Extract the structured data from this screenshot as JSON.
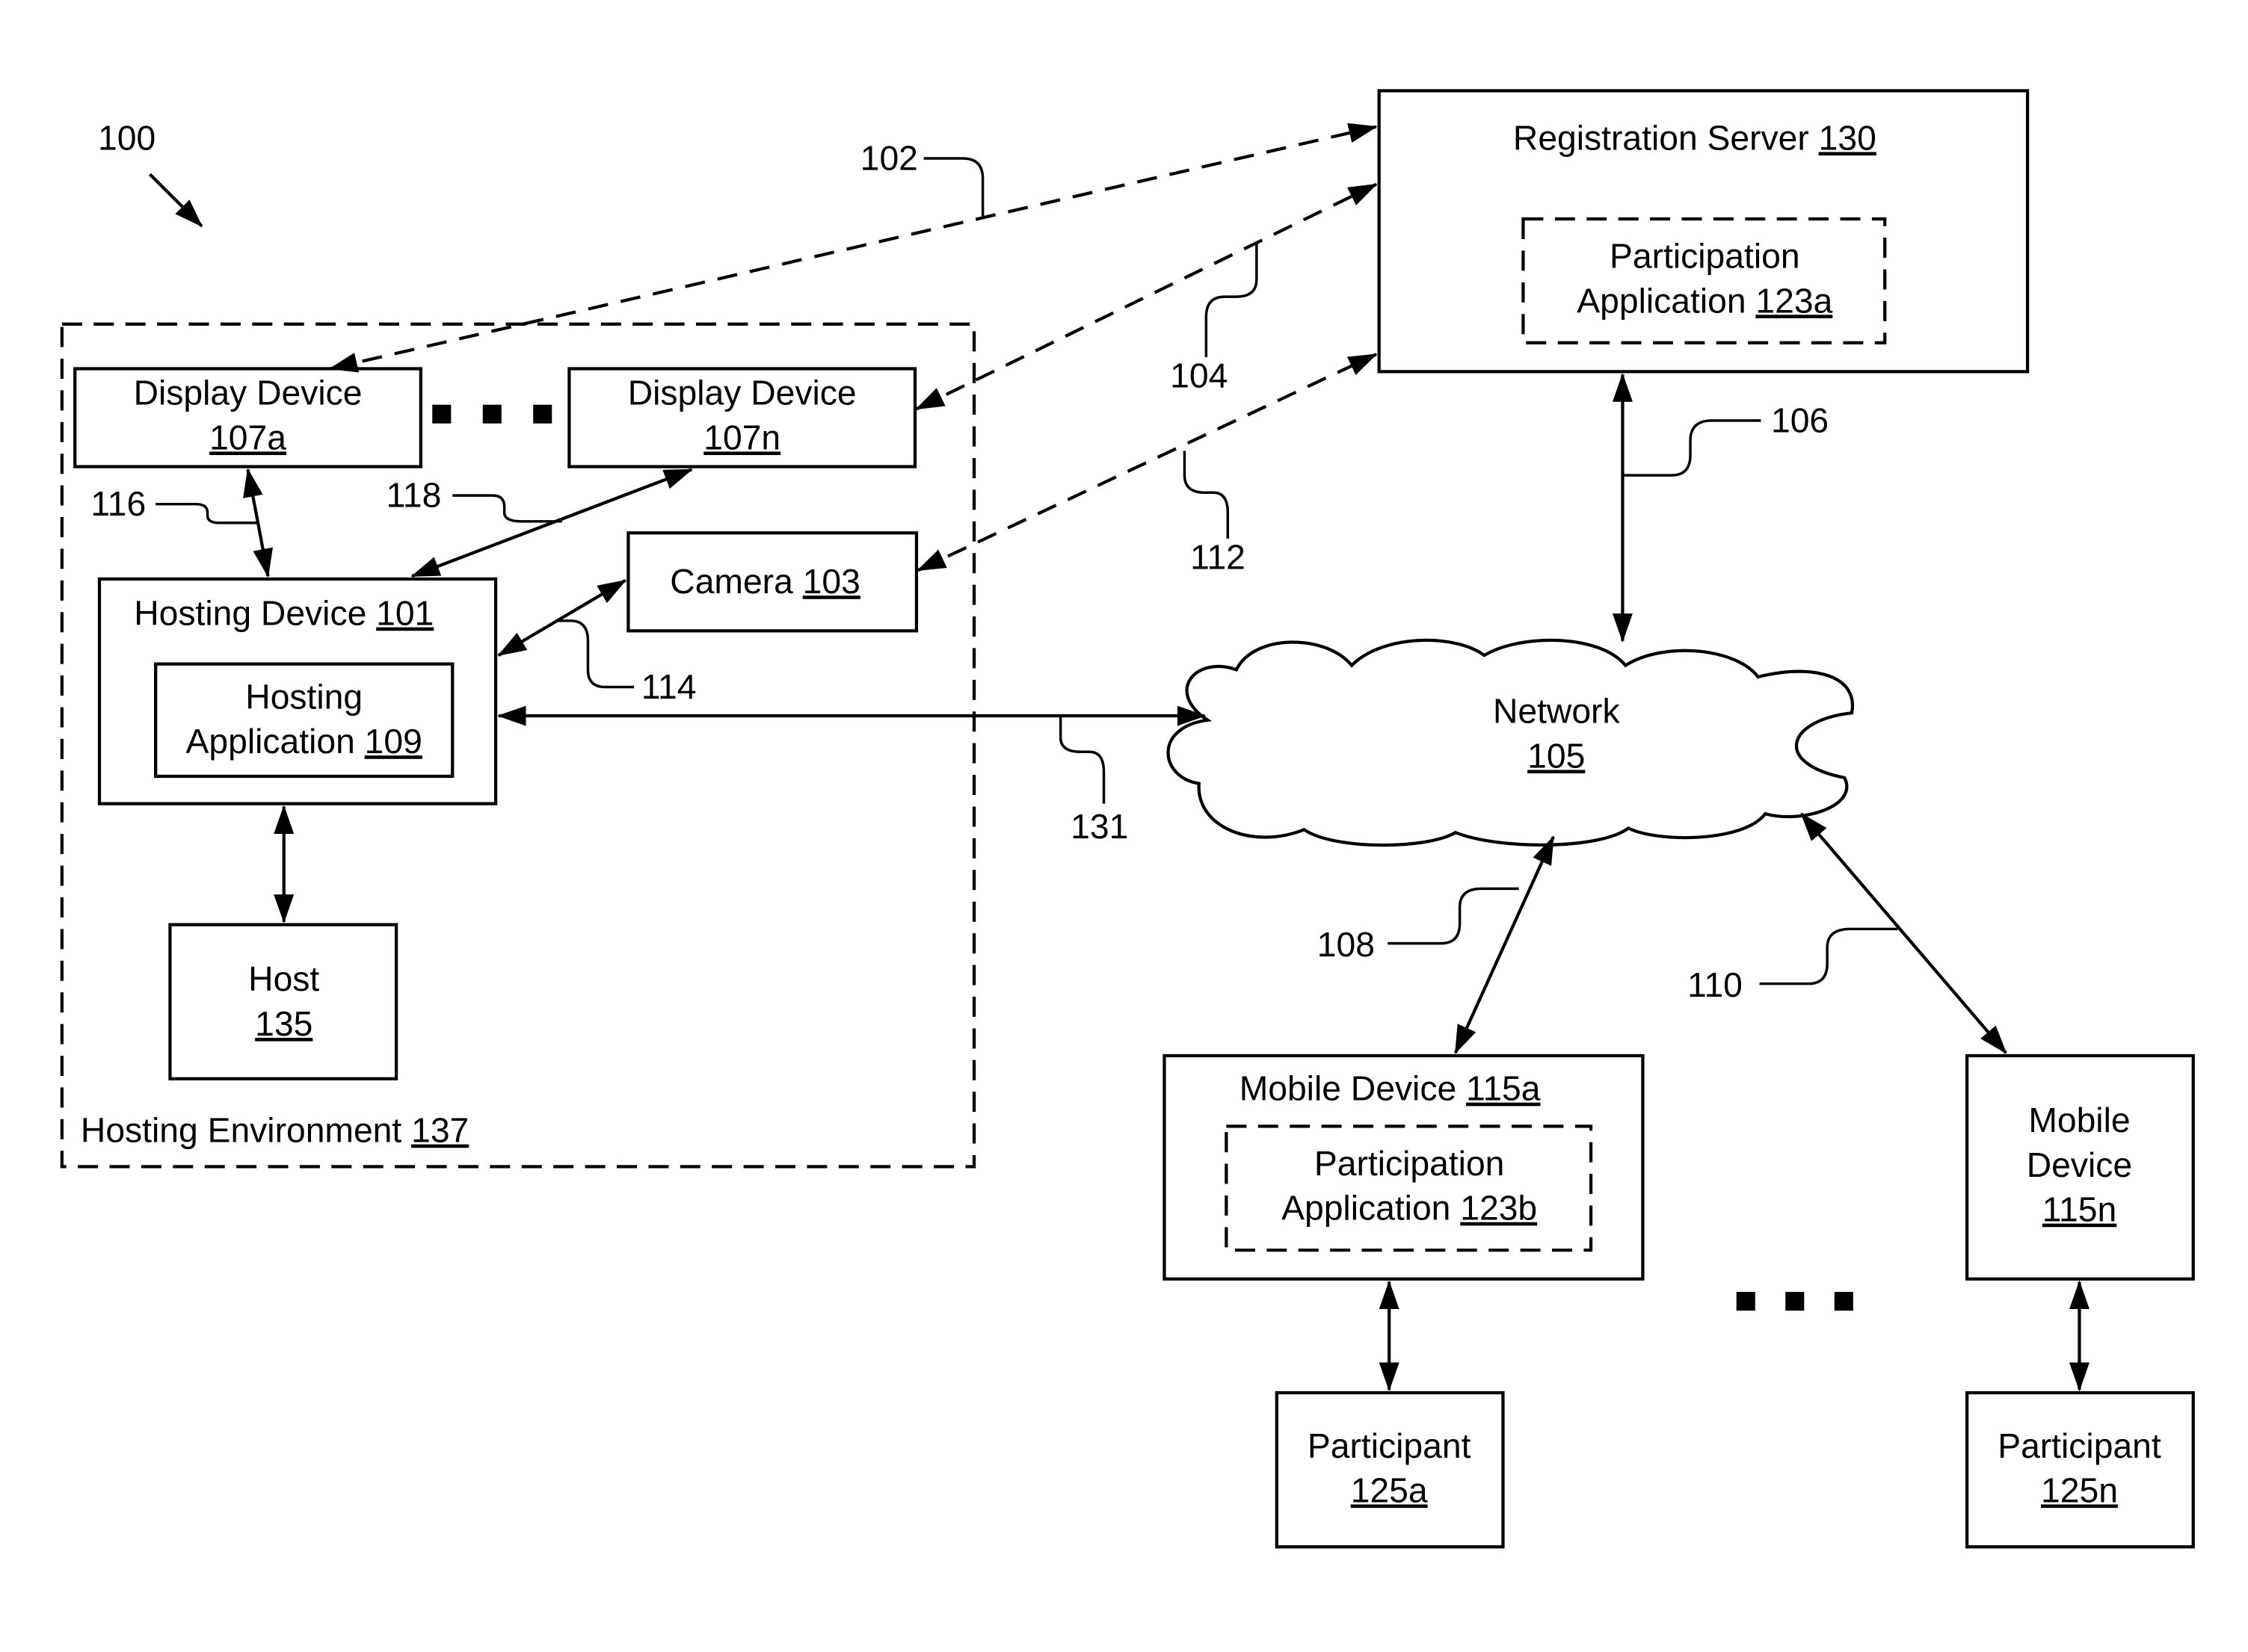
{
  "figure": {
    "reference": "100",
    "colors": {
      "ink": "#000000",
      "background": "#ffffff"
    }
  },
  "hosting_environment": {
    "label": "Hosting Environment",
    "ref": "137"
  },
  "display_device_a": {
    "label": "Display Device",
    "ref": "107a"
  },
  "display_device_n": {
    "label": "Display Device",
    "ref": "107n"
  },
  "camera": {
    "label": "Camera",
    "ref": "103"
  },
  "hosting_device": {
    "label": "Hosting Device",
    "ref": "101"
  },
  "hosting_application": {
    "line1": "Hosting",
    "line2": "Application",
    "ref": "109"
  },
  "host": {
    "label": "Host",
    "ref": "135"
  },
  "registration_server": {
    "label": "Registration Server",
    "ref": "130"
  },
  "participation_app_a": {
    "line1": "Participation",
    "line2": "Application",
    "ref": "123a"
  },
  "network": {
    "label": "Network",
    "ref": "105"
  },
  "mobile_device_a": {
    "label": "Mobile Device",
    "ref": "115a"
  },
  "participation_app_b": {
    "line1": "Participation",
    "line2": "Application",
    "ref": "123b"
  },
  "mobile_device_n": {
    "line1": "Mobile",
    "line2": "Device",
    "ref": "115n"
  },
  "participant_a": {
    "label": "Participant",
    "ref": "125a"
  },
  "participant_n": {
    "label": "Participant",
    "ref": "125n"
  },
  "connections": {
    "c102": "102",
    "c104": "104",
    "c106": "106",
    "c108": "108",
    "c110": "110",
    "c112": "112",
    "c114": "114",
    "c116": "116",
    "c118": "118",
    "c131": "131"
  }
}
